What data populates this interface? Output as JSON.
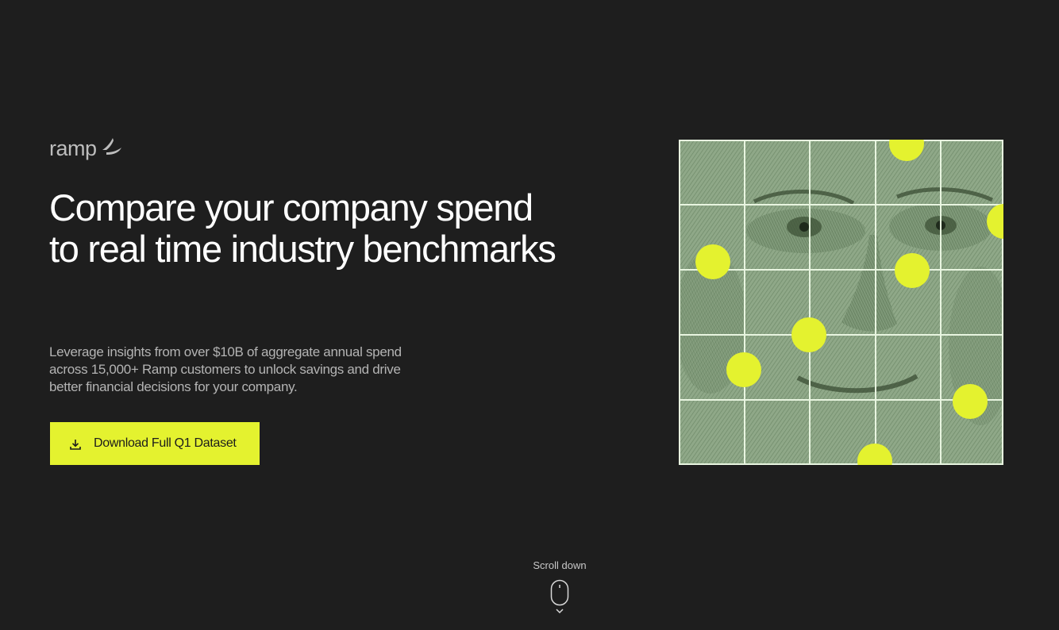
{
  "brand": {
    "name": "ramp",
    "icon": "ramp-mark-icon",
    "logo_color": "#bdbdbd"
  },
  "hero": {
    "headline": "Compare your company spend to real time industry benchmarks",
    "subtext": "Leverage insights from over $10B of aggregate annual spend across 15,000+ Ramp customers to unlock savings and drive better financial decisions for your company.",
    "cta": {
      "label": "Download Full Q1 Dataset",
      "icon": "download-icon",
      "color": "#e4f22f"
    },
    "artwork": {
      "description_icon": "banknote-portrait-grid-image",
      "dot_color": "#e4f22f",
      "grid_color": "#e8f5e0"
    }
  },
  "scroll_hint": {
    "label": "Scroll down",
    "icons": [
      "mouse-icon",
      "chevron-down-icon"
    ]
  },
  "colors": {
    "background": "#1e1e1e",
    "accent": "#e4f22f",
    "text_primary": "#ffffff",
    "text_secondary": "#b4b4b4"
  }
}
